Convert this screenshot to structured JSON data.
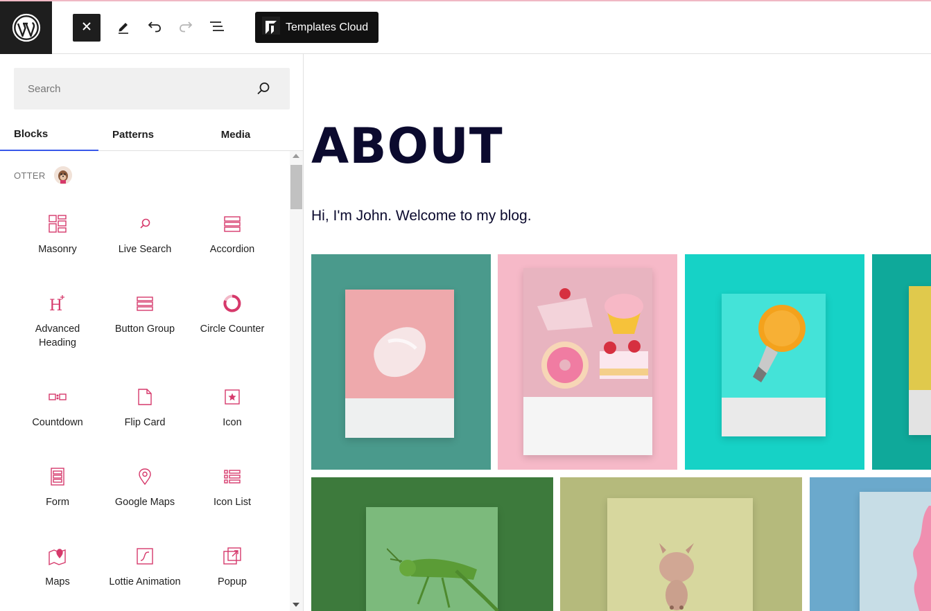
{
  "toolbar": {
    "close_icon": "close-icon",
    "edit_icon": "pencil-icon",
    "undo_icon": "undo-icon",
    "redo_icon": "redo-icon",
    "outline_icon": "list-view-icon",
    "templates_label": "Templates Cloud"
  },
  "inserter": {
    "search": {
      "placeholder": "Search",
      "value": ""
    },
    "tabs": [
      {
        "label": "Blocks",
        "active": true
      },
      {
        "label": "Patterns",
        "active": false
      },
      {
        "label": "Media",
        "active": false
      }
    ],
    "category": "OTTER",
    "blocks": [
      {
        "label": "Masonry",
        "icon": "masonry-icon"
      },
      {
        "label": "Live Search",
        "icon": "search-icon"
      },
      {
        "label": "Accordion",
        "icon": "accordion-icon"
      },
      {
        "label": "Advanced Heading",
        "icon": "heading-icon"
      },
      {
        "label": "Button Group",
        "icon": "button-group-icon"
      },
      {
        "label": "Circle Counter",
        "icon": "circle-counter-icon"
      },
      {
        "label": "Countdown",
        "icon": "countdown-icon"
      },
      {
        "label": "Flip Card",
        "icon": "flip-card-icon"
      },
      {
        "label": "Icon",
        "icon": "star-icon"
      },
      {
        "label": "Form",
        "icon": "form-icon"
      },
      {
        "label": "Google Maps",
        "icon": "map-pin-icon"
      },
      {
        "label": "Icon List",
        "icon": "icon-list-icon"
      },
      {
        "label": "Maps",
        "icon": "maps-icon"
      },
      {
        "label": "Lottie Animation",
        "icon": "lottie-icon"
      },
      {
        "label": "Popup",
        "icon": "popup-icon"
      }
    ]
  },
  "page": {
    "title": "ABOUT",
    "intro": "Hi, I'm John. Welcome to my blog."
  },
  "colors": {
    "accent": "#3858e9",
    "block_icon": "#d6396b",
    "title": "#0b0a2e"
  }
}
